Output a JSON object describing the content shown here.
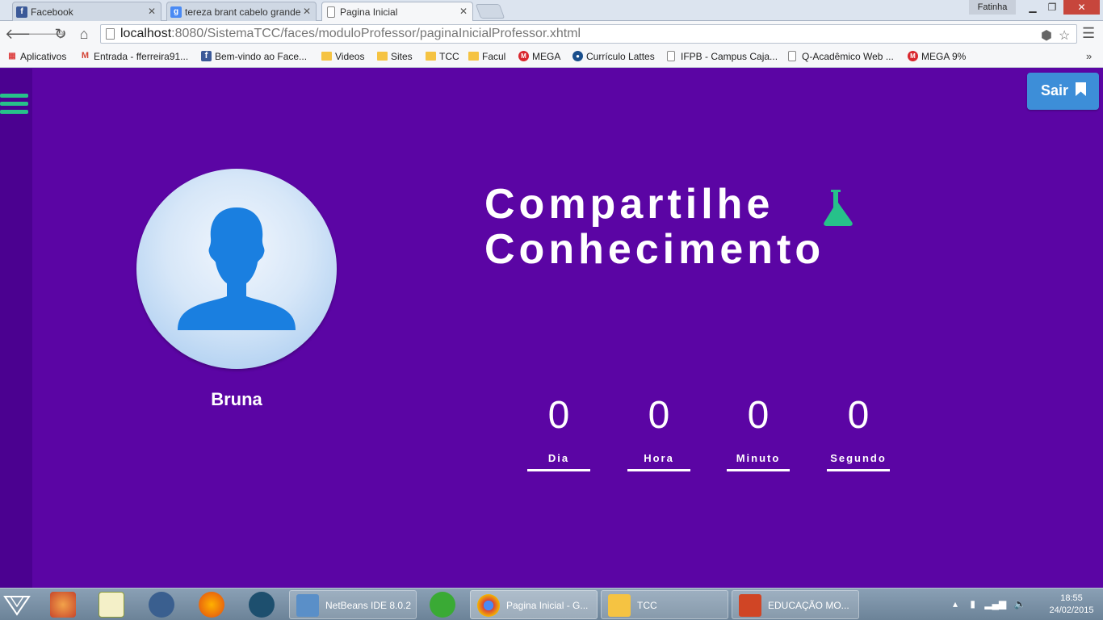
{
  "browser": {
    "tabs": [
      {
        "title": "Facebook",
        "active": false
      },
      {
        "title": "tereza brant cabelo grande",
        "active": false
      },
      {
        "title": "Pagina Inicial",
        "active": true
      }
    ],
    "user": "Fatinha",
    "url_host": "localhost",
    "url_path": ":8080/SistemaTCC/faces/moduloProfessor/paginaInicialProfessor.xhtml",
    "bookmarks": [
      {
        "label": "Aplicativos",
        "icon": "apps-icon"
      },
      {
        "label": "Entrada - fferreira91...",
        "icon": "gmail-icon"
      },
      {
        "label": "Bem-vindo ao Face...",
        "icon": "facebook-icon"
      },
      {
        "label": "Videos",
        "icon": "folder-icon"
      },
      {
        "label": "Sites",
        "icon": "folder-icon"
      },
      {
        "label": "TCC",
        "icon": "folder-icon"
      },
      {
        "label": "Facul",
        "icon": "folder-icon"
      },
      {
        "label": "MEGA",
        "icon": "mega-icon"
      },
      {
        "label": "Currículo Lattes",
        "icon": "lattes-icon"
      },
      {
        "label": "IFPB - Campus Caja...",
        "icon": "page-icon"
      },
      {
        "label": "Q-Acadêmico Web ...",
        "icon": "page-icon"
      },
      {
        "label": "MEGA 9%",
        "icon": "mega-icon"
      }
    ]
  },
  "page": {
    "logout_label": "Sair",
    "user_name": "Bruna",
    "headline_line1": "Compartilhe",
    "headline_line2": "Conhecimento",
    "countdown": [
      {
        "value": "0",
        "label": "Dia"
      },
      {
        "value": "0",
        "label": "Hora"
      },
      {
        "value": "0",
        "label": "Minuto"
      },
      {
        "value": "0",
        "label": "Segundo"
      }
    ],
    "colors": {
      "background": "#5b05a4",
      "sidebar": "#4b0190",
      "accent_green": "#27c18a",
      "logout_blue": "#3d8ed8",
      "avatar_blue": "#1a7fe0"
    }
  },
  "taskbar": {
    "apps": [
      {
        "label": "NetBeans IDE 8.0.2"
      },
      {
        "label": "Pagina Inicial - G..."
      },
      {
        "label": "TCC"
      },
      {
        "label": "EDUCAÇÃO  MO..."
      }
    ],
    "time": "18:55",
    "date": "24/02/2015"
  }
}
